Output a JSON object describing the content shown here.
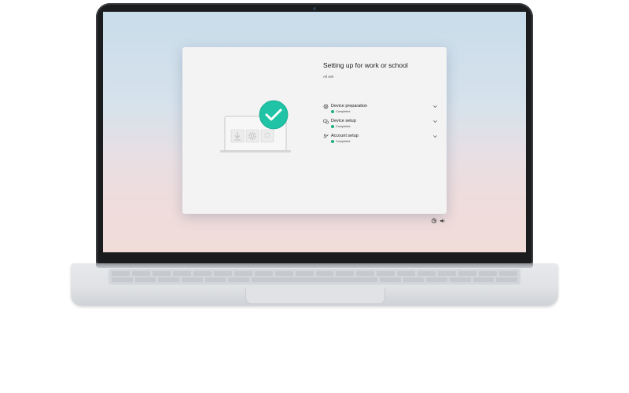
{
  "window": {
    "title": "Setting up for work or school",
    "subtitle": "All set!"
  },
  "steps": [
    {
      "label": "Device preparation",
      "status": "Completed",
      "icon": "gear-icon"
    },
    {
      "label": "Device setup",
      "status": "Completed",
      "icon": "devices-icon"
    },
    {
      "label": "Account setup",
      "status": "Completed",
      "icon": "person-key-icon"
    }
  ],
  "tray": {
    "icons": [
      "accessibility-icon",
      "volume-icon"
    ]
  },
  "colors": {
    "accent": "#20c3a5",
    "status_completed": "#1fae7e",
    "window_bg": "#f3f3f3"
  }
}
